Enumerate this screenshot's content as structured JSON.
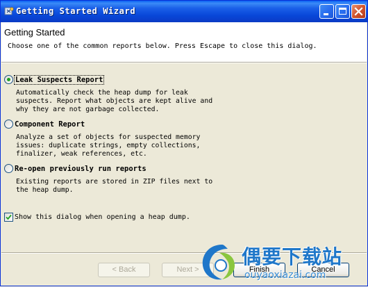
{
  "window": {
    "title": "Getting Started Wizard",
    "accent": "#0a5ae8"
  },
  "header": {
    "title": "Getting Started",
    "description": "Choose one of the common reports below. Press Escape to close this dialog."
  },
  "options": [
    {
      "label": "Leak Suspects Report",
      "selected": true,
      "lines": [
        "Automatically check the heap dump for leak",
        "suspects. Report what objects are kept alive and",
        "why they are not garbage collected."
      ]
    },
    {
      "label": "Component Report",
      "selected": false,
      "lines": [
        "Analyze a set of objects for suspected memory",
        "issues: duplicate strings, empty collections,",
        "finalizer, weak references, etc."
      ]
    },
    {
      "label": "Re-open previously run reports",
      "selected": false,
      "lines": [
        "Existing reports are stored in ZIP files next to",
        "the heap dump."
      ]
    }
  ],
  "show_dialog": {
    "label": "Show this dialog when opening a heap dump.",
    "checked": true
  },
  "buttons": {
    "back": "< Back",
    "next": "Next >",
    "finish": "Finish",
    "cancel": "Cancel"
  },
  "watermark": {
    "site_name": "偶要下载站",
    "url": "ouyaoxiazai.com"
  },
  "icons": {
    "app": "app-icon",
    "minimize": "minimize-icon",
    "maximize": "maximize-icon",
    "close": "close-icon"
  }
}
